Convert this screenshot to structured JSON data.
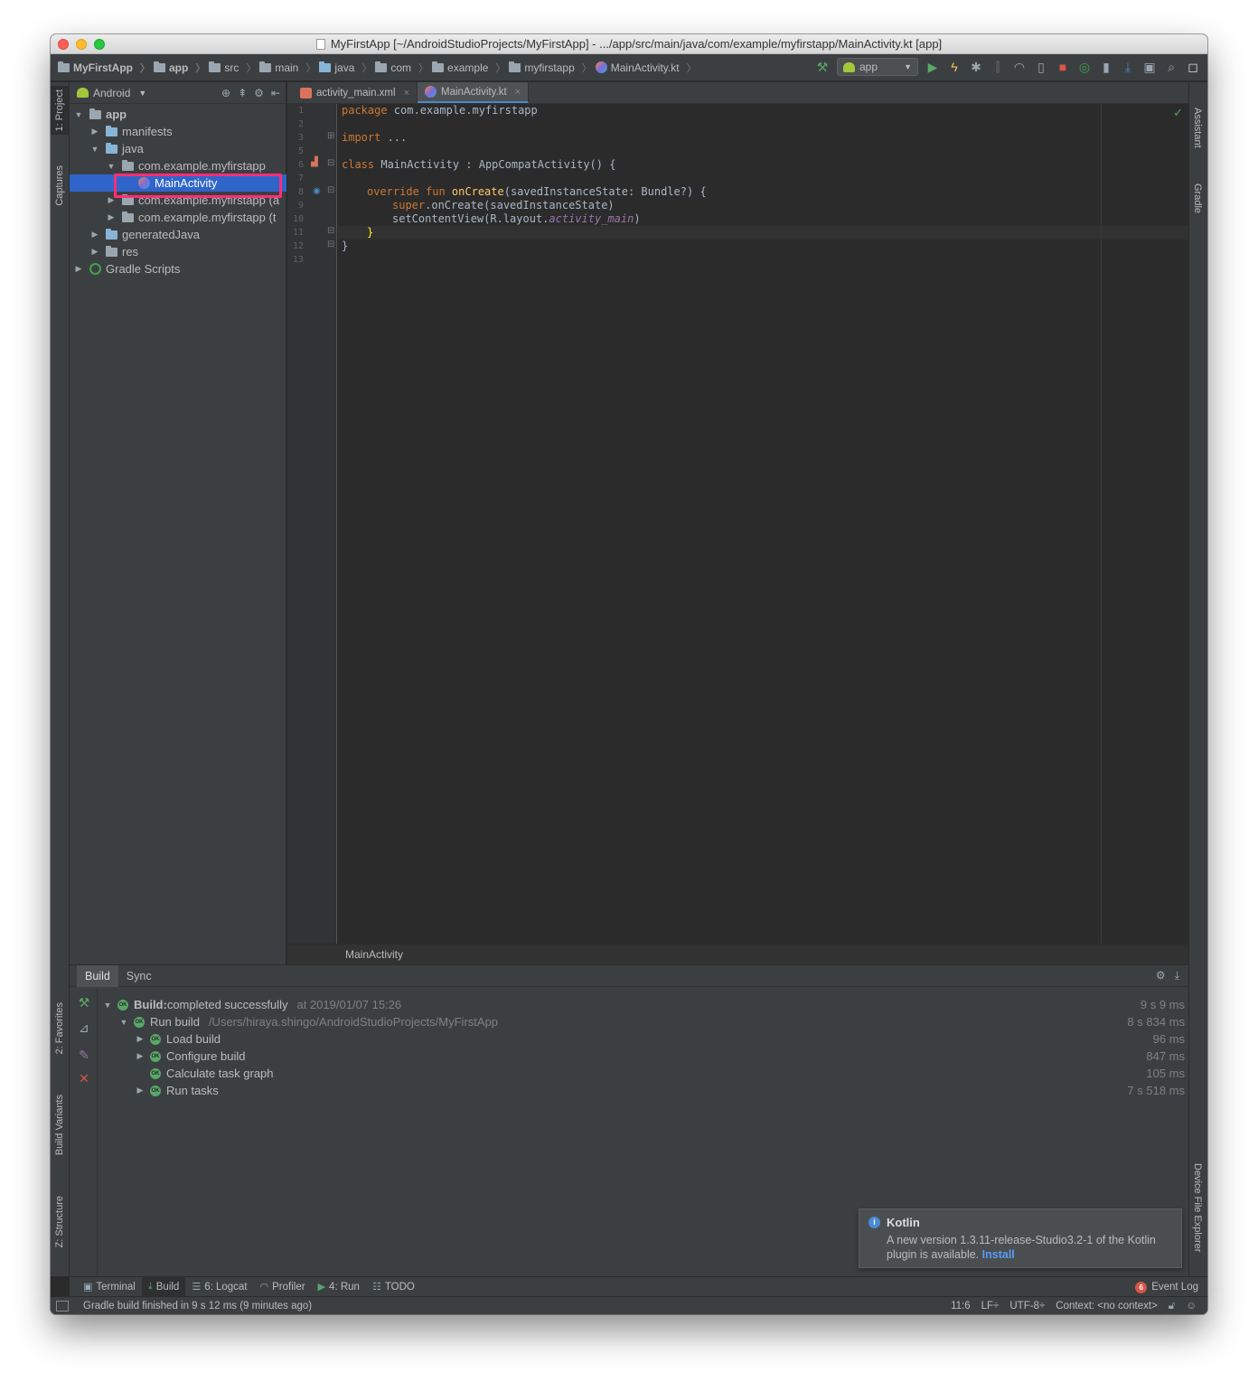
{
  "window": {
    "title": "MyFirstApp [~/AndroidStudioProjects/MyFirstApp] - .../app/src/main/java/com/example/myfirstapp/MainActivity.kt [app]"
  },
  "navbar": {
    "crumbs": [
      "MyFirstApp",
      "app",
      "src",
      "main",
      "java",
      "com",
      "example",
      "myfirstapp",
      "MainActivity.kt"
    ],
    "run_config": "app"
  },
  "left_tabs": [
    "1: Project",
    "Captures",
    "2: Favorites",
    "Build Variants",
    "Z: Structure"
  ],
  "right_tabs": [
    "Assistant",
    "Gradle",
    "Device File Explorer"
  ],
  "project": {
    "view": "Android",
    "tree": [
      {
        "label": "app",
        "arrow": "▼"
      },
      {
        "label": "manifests",
        "arrow": "▶"
      },
      {
        "label": "java",
        "arrow": "▼"
      },
      {
        "label": "com.example.myfirstapp",
        "arrow": "▼"
      },
      {
        "label": "MainActivity",
        "arrow": ""
      },
      {
        "label": "com.example.myfirstapp (a",
        "arrow": "▶"
      },
      {
        "label": "com.example.myfirstapp (t",
        "arrow": "▶"
      },
      {
        "label": "generatedJava",
        "arrow": "▶"
      },
      {
        "label": "res",
        "arrow": "▶"
      },
      {
        "label": "Gradle Scripts",
        "arrow": "▶"
      }
    ]
  },
  "editor": {
    "tabs": [
      "activity_main.xml",
      "MainActivity.kt"
    ],
    "active_tab": "MainActivity.kt",
    "line_numbers": [
      "1",
      "2",
      "3",
      "5",
      "6",
      "7",
      "8",
      "9",
      "10",
      "11",
      "12",
      "13"
    ],
    "breadcrumb": "MainActivity",
    "code": {
      "l1_kw": "package",
      "l1_rest": " com.example.myfirstapp",
      "l3_kw": "import",
      "l3_rest": " ...",
      "l6_kw": "class",
      "l6_rest": " MainActivity : AppCompatActivity() {",
      "l8_kw": "override fun ",
      "l8_fn": "onCreate",
      "l8_rest": "(savedInstanceState: Bundle?) {",
      "l9_kw": "super",
      "l9_rest": ".onCreate(savedInstanceState)",
      "l10_a": "setContentView(R.layout.",
      "l10_it": "activity_main",
      "l10_b": ")",
      "l11": "}",
      "l12": "}"
    }
  },
  "build": {
    "tabs": [
      "Build",
      "Sync"
    ],
    "rows": [
      {
        "label": "Build:",
        "label2": " completed successfully",
        "extra": "at 2019/01/07 15:26",
        "time": "9 s 9 ms",
        "arrow": "▼"
      },
      {
        "label": "Run build",
        "extra": "/Users/hiraya.shingo/AndroidStudioProjects/MyFirstApp",
        "time": "8 s 834 ms",
        "arrow": "▼"
      },
      {
        "label": "Load build",
        "time": "96 ms",
        "arrow": "▶"
      },
      {
        "label": "Configure build",
        "time": "847 ms",
        "arrow": "▶"
      },
      {
        "label": "Calculate task graph",
        "time": "105 ms",
        "arrow": ""
      },
      {
        "label": "Run tasks",
        "time": "7 s 518 ms",
        "arrow": "▶"
      }
    ]
  },
  "notification": {
    "title": "Kotlin",
    "body": "A new version 1.3.11-release-Studio3.2-1 of the Kotlin plugin is available.",
    "link": "Install"
  },
  "bottom_tools": [
    "Terminal",
    "Build",
    "6: Logcat",
    "Profiler",
    "4: Run",
    "TODO"
  ],
  "event_log": {
    "label": "Event Log",
    "count": "6"
  },
  "status": {
    "message": "Gradle build finished in 9 s 12 ms (9 minutes ago)",
    "position": "11:6",
    "line_sep": "LF÷",
    "encoding": "UTF-8÷",
    "context": "Context: <no context>"
  }
}
